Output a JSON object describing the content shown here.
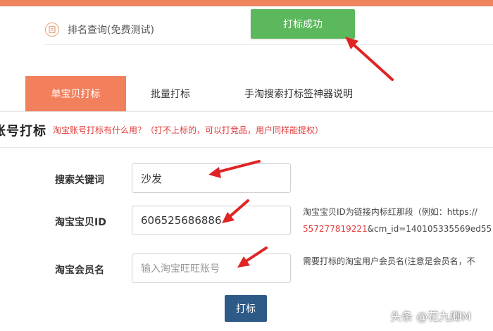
{
  "header": {
    "rank_query": "排名查询(免费测试)",
    "success_button": "打标成功"
  },
  "tabs": [
    {
      "label": "单宝贝打标",
      "active": true
    },
    {
      "label": "批量打标",
      "active": false
    },
    {
      "label": "手淘搜索打标签神器说明",
      "active": false
    }
  ],
  "section": {
    "title": "账号打标",
    "note": "淘宝账号打标有什么用？（打不上标的，可以打竞品，用户同样能提权）"
  },
  "form": {
    "keyword": {
      "label": "搜索关键词",
      "value": "沙发"
    },
    "item_id": {
      "label": "淘宝宝贝ID",
      "value": "606525686886",
      "help_line1": "淘宝宝贝ID为链接内标红那段（例如：https://",
      "help_red": "557277819221",
      "help_rest": "&cm_id=140105335569ed55"
    },
    "member": {
      "label": "淘宝会员名",
      "value": "",
      "placeholder": "输入淘宝旺旺账号",
      "help": "需要打标的淘宝用户会员名(注意是会员名，不"
    },
    "submit_label": "打标"
  },
  "watermark": "头条 @花九卿M",
  "colors": {
    "accent": "#f3805c",
    "success": "#5cb85c",
    "primary": "#2e5a87",
    "arrow": "#e02424",
    "note_red": "#e23b3b"
  }
}
